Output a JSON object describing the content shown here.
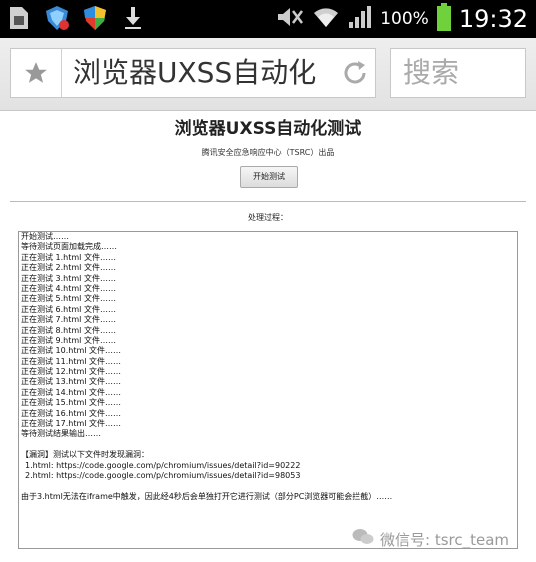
{
  "statusbar": {
    "battery": "100%",
    "time": "19:32",
    "icons_left": [
      "sim-card-icon",
      "shield-icon",
      "security-shield-icon",
      "download-icon"
    ],
    "icons_right": [
      "mute-icon",
      "wifi-icon",
      "signal-icon",
      "battery-icon"
    ]
  },
  "browser": {
    "url_text": "浏览器UXSS自动化",
    "search_text": "搜索"
  },
  "page": {
    "title": "浏览器UXSS自动化测试",
    "subtitle": "腾讯安全应急响应中心（TSRC）出品",
    "start_button": "开始测试",
    "process_label": "处理过程："
  },
  "log": {
    "lines": [
      "开始测试……",
      "等待测试页面加载完成……",
      "正在测试 1.html 文件……",
      "正在测试 2.html 文件……",
      "正在测试 3.html 文件……",
      "正在测试 4.html 文件……",
      "正在测试 5.html 文件……",
      "正在测试 6.html 文件……",
      "正在测试 7.html 文件……",
      "正在测试 8.html 文件……",
      "正在测试 9.html 文件……",
      "正在测试 10.html 文件……",
      "正在测试 11.html 文件……",
      "正在测试 12.html 文件……",
      "正在测试 13.html 文件……",
      "正在测试 14.html 文件……",
      "正在测试 15.html 文件……",
      "正在测试 16.html 文件……",
      "正在测试 17.html 文件……",
      "等待测试结果输出……"
    ],
    "vuln_header": "【漏洞】测试以下文件时发现漏洞：",
    "vulns": [
      "1.html: https://code.google.com/p/chromium/issues/detail?id=90222",
      "2.html: https://code.google.com/p/chromium/issues/detail?id=98053"
    ],
    "note": "由于3.html无法在iframe中触发，因此经4秒后会单独打开它进行测试（部分PC浏览器可能会拦截）……"
  },
  "watermark": "微信号: tsrc_team"
}
